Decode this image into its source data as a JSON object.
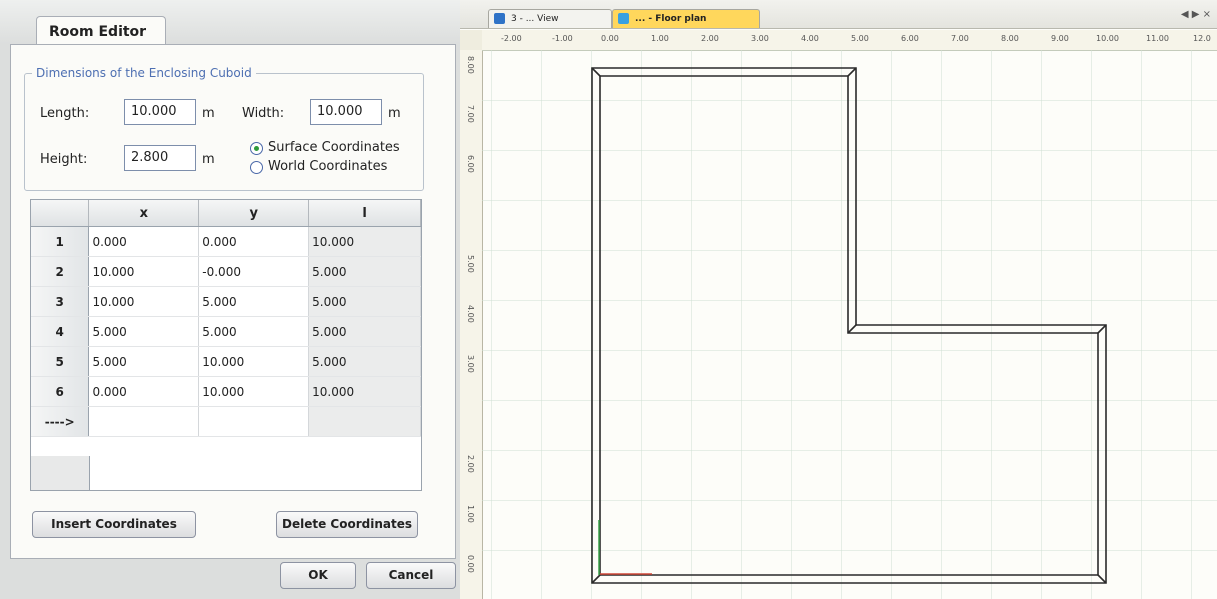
{
  "editor": {
    "tab_title": "Room Editor",
    "group_title": "Dimensions of the Enclosing Cuboid",
    "length_label": "Length:",
    "length_value": "10.000",
    "length_unit": "m",
    "width_label": "Width:",
    "width_value": "10.000",
    "width_unit": "m",
    "height_label": "Height:",
    "height_value": "2.800",
    "height_unit": "m",
    "radio_surface": "Surface Coordinates",
    "radio_world": "World Coordinates",
    "selected_coordinates": "Surface Coordinates",
    "columns": [
      "x",
      "y",
      "l"
    ],
    "rows": [
      {
        "n": "1",
        "x": "0.000",
        "y": "0.000",
        "l": "10.000"
      },
      {
        "n": "2",
        "x": "10.000",
        "y": "-0.000",
        "l": "5.000"
      },
      {
        "n": "3",
        "x": "10.000",
        "y": "5.000",
        "l": "5.000"
      },
      {
        "n": "4",
        "x": "5.000",
        "y": "5.000",
        "l": "5.000"
      },
      {
        "n": "5",
        "x": "5.000",
        "y": "10.000",
        "l": "5.000"
      },
      {
        "n": "6",
        "x": "0.000",
        "y": "10.000",
        "l": "10.000"
      }
    ],
    "new_row_marker": "---->",
    "insert_button": "Insert Coordinates",
    "delete_button": "Delete Coordinates",
    "ok_button": "OK",
    "cancel_button": "Cancel"
  },
  "viewer": {
    "tab1": "3 - ... View",
    "tab2": "... - Floor plan",
    "nav": "◀ ▶ ×",
    "ruler_h": [
      "-2.00",
      "-1.00",
      "0.00",
      "1.00",
      "2.00",
      "3.00",
      "4.00",
      "5.00",
      "6.00",
      "7.00",
      "8.00",
      "9.00",
      "10.00",
      "11.00",
      "12.0"
    ],
    "ruler_v": [
      "8.00",
      "7.00",
      "6.00",
      "5.00",
      "4.00",
      "3.00",
      "2.00",
      "1.00",
      "0.00"
    ],
    "colors": {
      "grid": "#cfe0d2",
      "wall": "#2a2a2a",
      "tab_active": "#ffd75c",
      "ruler_bg": "#f6f4e9"
    }
  }
}
